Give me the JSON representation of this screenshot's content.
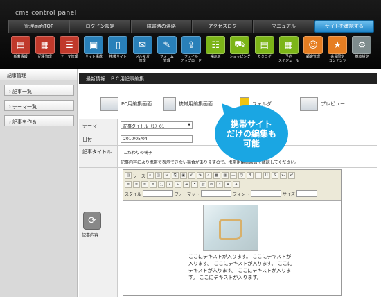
{
  "brand": "cms control panel",
  "main_nav": [
    "管理画面TOP",
    "ログイン設定",
    "障害時の連絡",
    "アクセスログ",
    "マニュアル"
  ],
  "site_button": "サイトを確認する",
  "icon_bar": [
    {
      "label": "新着情報",
      "icon": "news-icon",
      "color": "#c0392b"
    },
    {
      "label": "記事管理",
      "icon": "article-icon",
      "color": "#c0392b"
    },
    {
      "label": "テーマ管理",
      "icon": "theme-icon",
      "color": "#c0392b"
    },
    {
      "label": "サイト構成",
      "icon": "site-structure-icon",
      "color": "#2980b9"
    },
    {
      "label": "携帯サイト",
      "icon": "mobile-icon",
      "color": "#2980b9"
    },
    {
      "label": "メルマガ\n管理",
      "icon": "mail-icon",
      "color": "#2980b9"
    },
    {
      "label": "フォーム\n管理",
      "icon": "form-icon",
      "color": "#2980b9"
    },
    {
      "label": "ファイル\nアップロード",
      "icon": "upload-icon",
      "color": "#2980b9"
    },
    {
      "label": "掲示板",
      "icon": "bbs-icon",
      "color": "#7cb518"
    },
    {
      "label": "ショッピング",
      "icon": "shopping-icon",
      "color": "#7cb518"
    },
    {
      "label": "カタログ",
      "icon": "catalog-icon",
      "color": "#7cb518"
    },
    {
      "label": "予約\nスケジュール",
      "icon": "schedule-icon",
      "color": "#7cb518"
    },
    {
      "label": "顧客管理",
      "icon": "customer-icon",
      "color": "#e67e22"
    },
    {
      "label": "会員限定\nコンテンツ",
      "icon": "member-icon",
      "color": "#e67e22"
    },
    {
      "label": "基本設定",
      "icon": "settings-icon",
      "color": "#7f8c8d"
    }
  ],
  "sidebar": {
    "title": "記事管理",
    "items": [
      "記事一覧",
      "テーマ一覧",
      "記事を作る"
    ]
  },
  "breadcrumb": "最新情報　ＰＣ用記事編集",
  "edit_tabs": [
    "PC用編集画面",
    "携帯用編集画面",
    "フォルダ",
    "プレビュー"
  ],
  "form": {
    "theme_label": "テーマ",
    "theme_value": "記事タイトル（1）01",
    "date_label": "日付",
    "date_value": "2010/05/04",
    "title_label": "記事タイトル",
    "title_value": "こだわりの椅子",
    "content_label": "記事内容",
    "notice": "記事内容により携帯で表示できない場合がありますので、携帯用編集画面で確認してください。"
  },
  "editor": {
    "source_label": "ソース",
    "style_label": "スタイル",
    "format_label": "フォーマット",
    "font_label": "フォント",
    "size_label": "サイズ",
    "body_text": "ここにテキストが入ります。 ここにテキストが入ります。 ここにテキストが入ります。 ここにテキストが入ります。 ここにテキストが入ります。 ここにテキストが入ります。"
  },
  "callout_text": "携帯サイト\nだけの編集も\n可能"
}
